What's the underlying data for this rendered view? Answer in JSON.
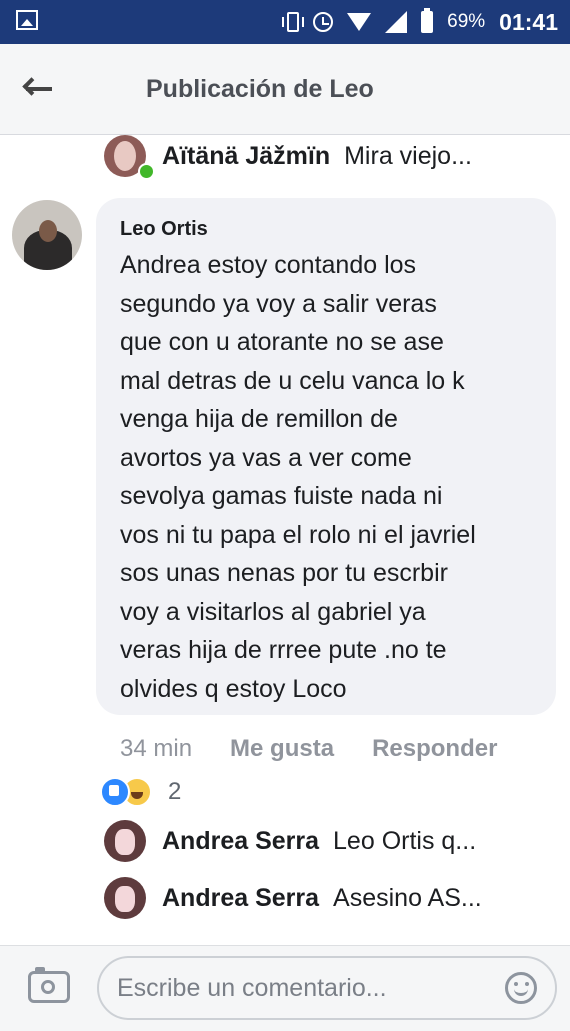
{
  "status_bar": {
    "battery": "69%",
    "time": "01:41"
  },
  "header": {
    "title": "Publicación de Leo"
  },
  "top_reply": {
    "name": "Aïtänä Jäžmïn",
    "text": "Mira viejo..."
  },
  "comment": {
    "author": "Leo Ortis",
    "lines": [
      "Andrea estoy contando los",
      "segundo ya voy a salir veras",
      "que con u atorante no se ase",
      "mal detras de u celu vanca lo k",
      "venga hija de remillon de",
      "avortos ya vas a ver come",
      "sevolya gamas fuiste nada ni",
      "vos ni tu papa el rolo ni el javriel",
      "sos unas nenas por tu escrbir",
      "voy a visitarlos al gabriel ya",
      "veras hija de rrree pute .no te",
      "olvides q estoy Loco"
    ],
    "time": "34 min",
    "like_label": "Me gusta",
    "reply_label": "Responder",
    "reaction_count": "2"
  },
  "replies": [
    {
      "name": "Andrea Serra",
      "text": "Leo Ortis q..."
    },
    {
      "name": "Andrea Serra",
      "text": "Asesino AS..."
    }
  ],
  "composer": {
    "placeholder": "Escribe un comentario..."
  },
  "colors": {
    "status_bar": "#1d3a7a",
    "like_blue": "#2d88ff",
    "haha_yellow": "#f7c94a",
    "online_green": "#42b72a"
  },
  "icons": [
    "gallery-icon",
    "vibrate-icon",
    "alarm-icon",
    "wifi-icon",
    "signal-icon",
    "battery-icon",
    "back-arrow-icon",
    "like-reaction-icon",
    "haha-reaction-icon",
    "camera-icon",
    "emoji-icon"
  ]
}
